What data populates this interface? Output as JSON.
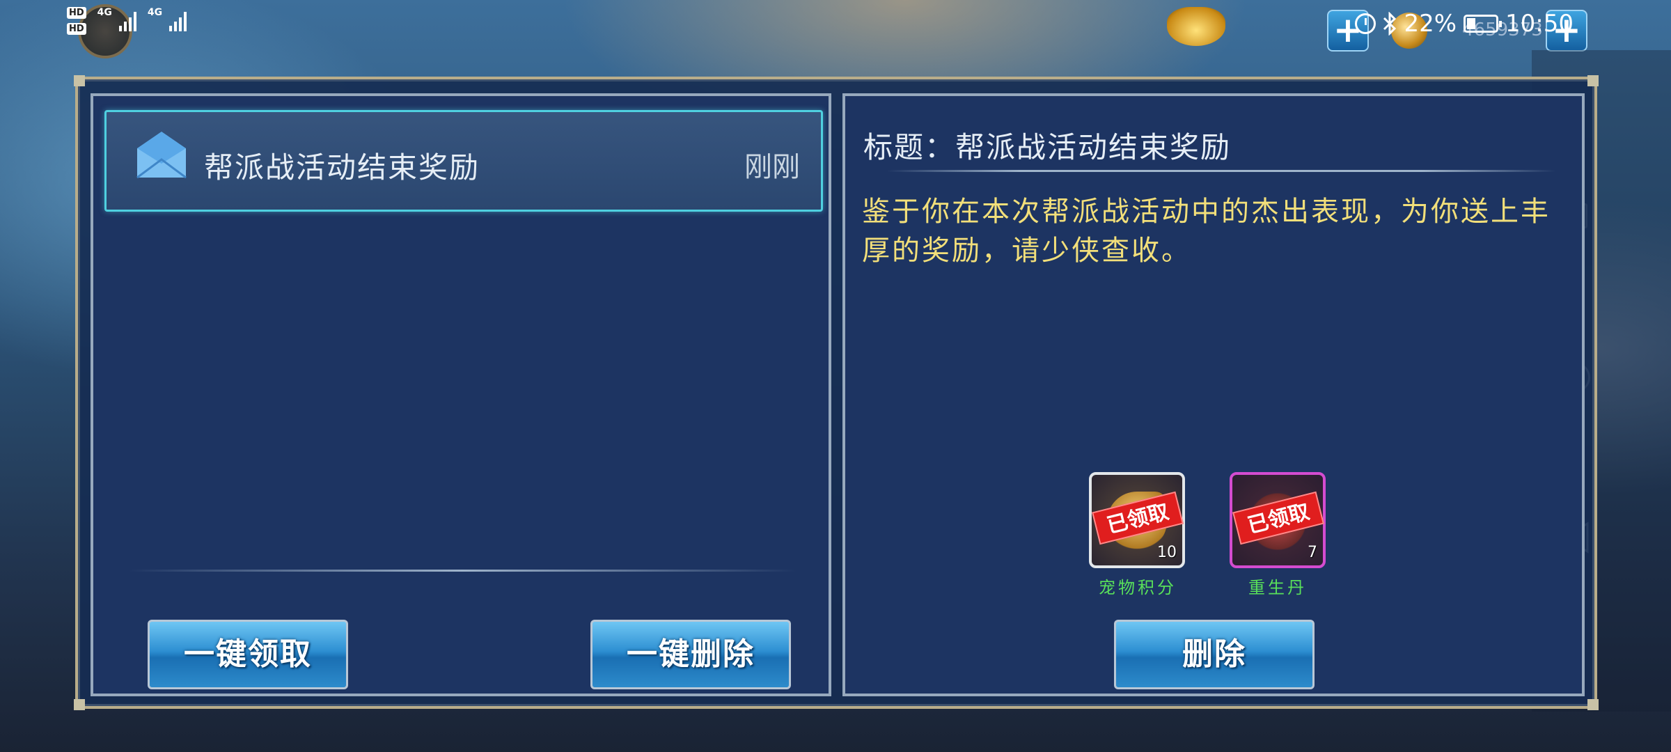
{
  "status_bar": {
    "hd1": "HD",
    "hd2": "HD",
    "net1": "4G",
    "net2": "4G",
    "battery_percent": "22%",
    "time": "10:50",
    "gold_amount": "4659373",
    "plus": "+"
  },
  "mail_list": {
    "items": [
      {
        "title": "帮派战活动结束奖励",
        "time": "刚刚"
      }
    ]
  },
  "left_buttons": {
    "claim_all": "一键领取",
    "delete_all": "一键删除"
  },
  "detail": {
    "title": "标题：帮派战活动结束奖励",
    "body": "鉴于你在本次帮派战活动中的杰出表现，为你送上丰厚的奖励，请少侠查收。",
    "rewards": [
      {
        "name": "宠物积分",
        "count": "10",
        "status": "已领取",
        "rarity": "white"
      },
      {
        "name": "重生丹",
        "count": "7",
        "status": "已领取",
        "rarity": "purple"
      }
    ],
    "delete_button": "删除"
  },
  "colors": {
    "accent_cyan": "#4fd0e0",
    "body_text_gold": "#f2df7a",
    "item_name_green": "#59e05a",
    "claimed_red": "#e01e1e"
  },
  "icons": [
    "envelope-icon",
    "alarm-icon",
    "bluetooth-icon",
    "battery-icon",
    "gold-ingot-icon",
    "coin-icon",
    "nav-recents-icon",
    "nav-home-icon",
    "nav-back-icon"
  ]
}
